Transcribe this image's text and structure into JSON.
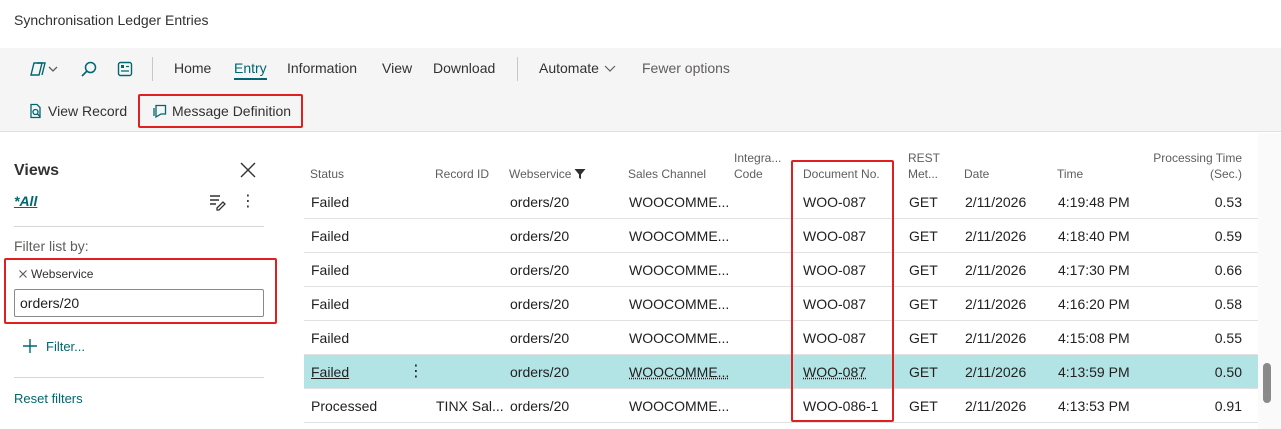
{
  "page": {
    "title": "Synchronisation Ledger Entries"
  },
  "toolbar": {
    "nav": [
      "Home",
      "Entry",
      "Information",
      "View",
      "Download"
    ],
    "active_nav": "Entry",
    "automate": "Automate",
    "fewer_options": "Fewer options"
  },
  "commands": {
    "view_record": "View Record",
    "message_definition": "Message Definition"
  },
  "sidebar": {
    "views_title": "Views",
    "all_view": "*All",
    "filter_label": "Filter list by:",
    "filter_field": "Webservice",
    "filter_value": "orders/20",
    "add_filter": "Filter...",
    "reset": "Reset filters"
  },
  "table": {
    "headers": {
      "status": "Status",
      "record_id": "Record ID",
      "webservice": "Webservice",
      "sales_channel": "Sales Channel",
      "integra_line1": "Integra...",
      "integra_line2": "Code",
      "document_no": "Document No.",
      "rest_line1": "REST",
      "rest_line2": "Met...",
      "date": "Date",
      "time": "Time",
      "proc_line1": "Processing Time",
      "proc_line2": "(Sec.)"
    },
    "rows": [
      {
        "status": "Failed",
        "record_id": "",
        "webservice": "orders/20",
        "sales_channel": "WOOCOMME...",
        "integration_code": "",
        "document_no": "WOO-087",
        "rest_method": "GET",
        "date": "2/11/2026",
        "time": "4:19:48 PM",
        "processing_time": "0.53"
      },
      {
        "status": "Failed",
        "record_id": "",
        "webservice": "orders/20",
        "sales_channel": "WOOCOMME...",
        "integration_code": "",
        "document_no": "WOO-087",
        "rest_method": "GET",
        "date": "2/11/2026",
        "time": "4:18:40 PM",
        "processing_time": "0.59"
      },
      {
        "status": "Failed",
        "record_id": "",
        "webservice": "orders/20",
        "sales_channel": "WOOCOMME...",
        "integration_code": "",
        "document_no": "WOO-087",
        "rest_method": "GET",
        "date": "2/11/2026",
        "time": "4:17:30 PM",
        "processing_time": "0.66"
      },
      {
        "status": "Failed",
        "record_id": "",
        "webservice": "orders/20",
        "sales_channel": "WOOCOMME...",
        "integration_code": "",
        "document_no": "WOO-087",
        "rest_method": "GET",
        "date": "2/11/2026",
        "time": "4:16:20 PM",
        "processing_time": "0.58"
      },
      {
        "status": "Failed",
        "record_id": "",
        "webservice": "orders/20",
        "sales_channel": "WOOCOMME...",
        "integration_code": "",
        "document_no": "WOO-087",
        "rest_method": "GET",
        "date": "2/11/2026",
        "time": "4:15:08 PM",
        "processing_time": "0.55"
      },
      {
        "status": "Failed",
        "record_id": "",
        "webservice": "orders/20",
        "sales_channel": "WOOCOMME...",
        "integration_code": "",
        "document_no": "WOO-087",
        "rest_method": "GET",
        "date": "2/11/2026",
        "time": "4:13:59 PM",
        "processing_time": "0.50",
        "selected": true
      },
      {
        "status": "Processed",
        "record_id": "TINX Sal...",
        "webservice": "orders/20",
        "sales_channel": "WOOCOMME...",
        "integration_code": "",
        "document_no": "WOO-086-1",
        "rest_method": "GET",
        "date": "2/11/2026",
        "time": "4:13:53 PM",
        "processing_time": "0.91"
      }
    ]
  },
  "colors": {
    "accent": "#00666f",
    "selected_row": "#b2e4e6",
    "highlight": "#e02020"
  },
  "icons": [
    "copilot-icon",
    "chevron-down-icon",
    "search-icon",
    "edit-list-icon",
    "view-record-icon",
    "message-definition-icon",
    "close-icon",
    "save-view-icon",
    "more-icon",
    "filter-icon",
    "plus-icon"
  ]
}
